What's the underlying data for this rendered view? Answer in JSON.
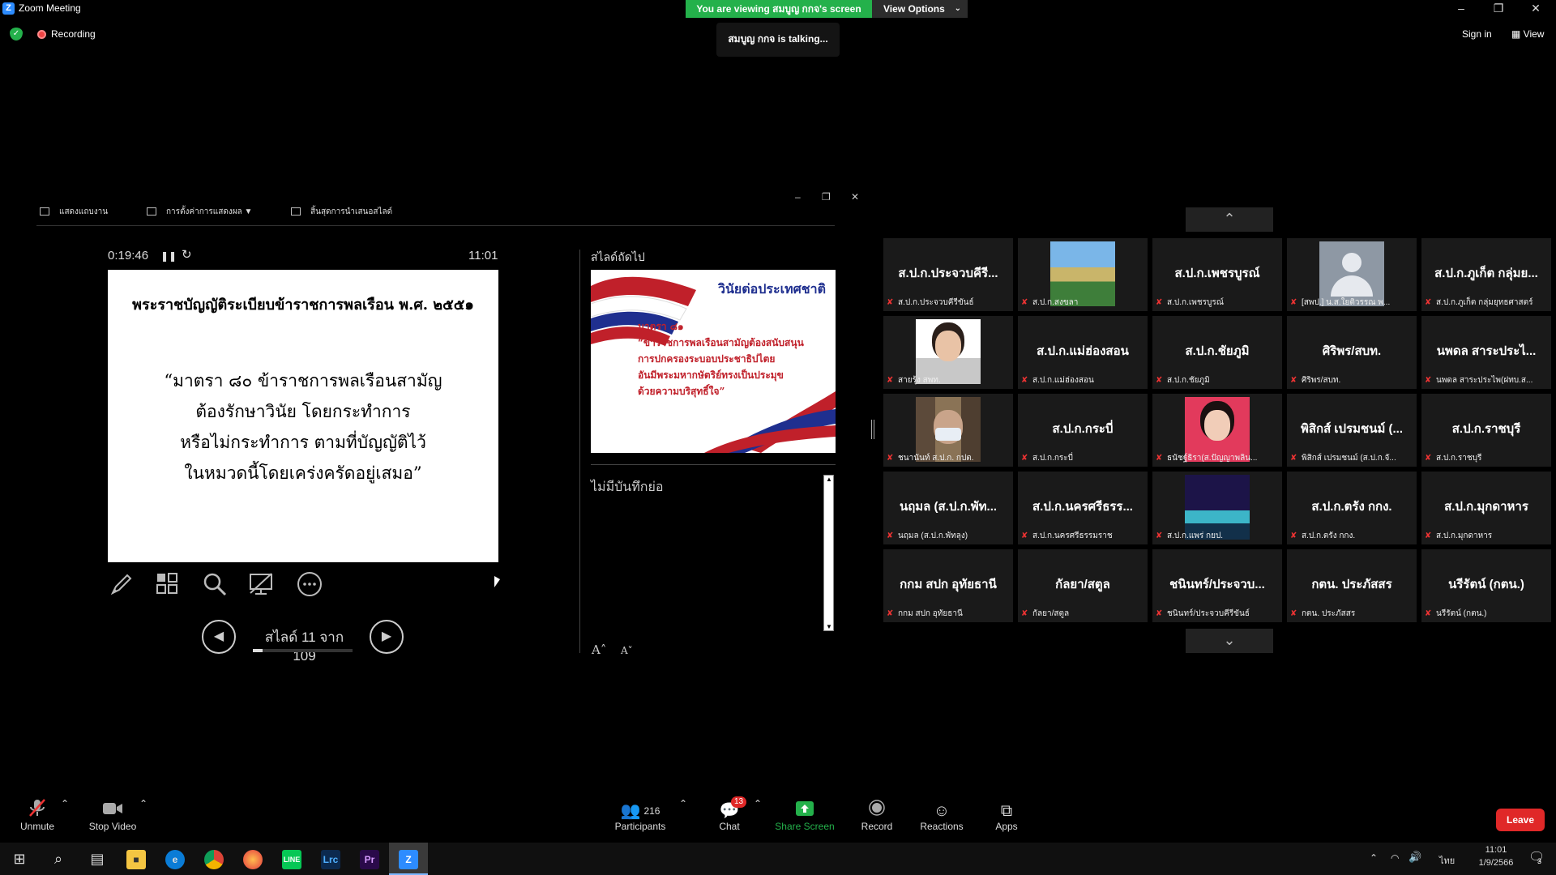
{
  "window": {
    "title": "Zoom Meeting",
    "viewing_banner": "You are viewing สมบูญ กกจ's screen",
    "view_options": "View Options",
    "talking": "สมบูญ กกจ is talking...",
    "recording": "Recording",
    "sign_in": "Sign in",
    "view": "View"
  },
  "presenter": {
    "toolbar": {
      "show_taskbar": "แสดงแถบงาน",
      "display_settings": "การตั้งค่าการแสดงผล ▼",
      "end_slideshow": "สิ้นสุดการนำเสนอสไลด์"
    },
    "timer": "0:19:46",
    "clock": "11:01",
    "current_slide": {
      "title": "พระราชบัญญัติระเบียบข้าราชการพลเรือน พ.ศ. ๒๕๕๑",
      "lines": [
        "“มาตรา ๘๐ ข้าราชการพลเรือนสามัญ",
        "ต้องรักษาวินัย โดยกระทำการ",
        "หรือไม่กระทำการ ตามที่บัญญัติไว้",
        "ในหมวดนี้โดยเคร่งครัดอยู่เสมอ”"
      ]
    },
    "slide_counter": "สไลด์ 11 จาก 109",
    "slide_progress": 0.1009,
    "next_label": "สไลด์ถัดไป",
    "next_slide": {
      "title": "วินัยต่อประเทศชาติ",
      "lines": [
        "มาตรา ๘๑",
        "“ข้าราชการพลเรือนสามัญต้องสนับสนุน",
        "การปกครองระบอบประชาธิปไตย",
        "อันมีพระมหากษัตริย์ทรงเป็นประมุข",
        "ด้วยความบริสุทธิ์ใจ”"
      ]
    },
    "notes": "ไม่มีบันทึกย่อ"
  },
  "gallery": {
    "tiles": [
      {
        "big": "ส.ป.ก.ประจวบคีรี...",
        "small": "ส.ป.ก.ประจวบคีรีขันธ์",
        "photo": ""
      },
      {
        "big": "",
        "small": "ส.ป.ก.สงขลา",
        "photo": "building"
      },
      {
        "big": "ส.ป.ก.เพชรบูรณ์",
        "small": "ส.ป.ก.เพชรบูรณ์",
        "photo": ""
      },
      {
        "big": "",
        "small": "[สพป.] น.ส.ใยติวรรณ พ...",
        "photo": "avatar"
      },
      {
        "big": "ส.ป.ก.ภูเก็ต กลุ่มย...",
        "small": "ส.ป.ก.ภูเก็ต กลุ่มยุทธศาสตร์",
        "photo": ""
      },
      {
        "big": "",
        "small": "สายรุ้ง สพท.",
        "photo": "woman"
      },
      {
        "big": "ส.ป.ก.แม่ฮ่องสอน",
        "small": "ส.ป.ก.แม่ฮ่องสอน",
        "photo": ""
      },
      {
        "big": "ส.ป.ก.ชัยภูมิ",
        "small": "ส.ป.ก.ชัยภูมิ",
        "photo": ""
      },
      {
        "big": "ศิริพร/สบท.",
        "small": "ศิริพร/สบท.",
        "photo": ""
      },
      {
        "big": "นพดล สาระประไ...",
        "small": "นพดล สาระประไพ(ฝทบ.ส...",
        "photo": ""
      },
      {
        "big": "",
        "small": "ชนานันท์ ส.ป.ก. กปต.",
        "photo": "man"
      },
      {
        "big": "ส.ป.ก.กระบี่",
        "small": "ส.ป.ก.กระบี่",
        "photo": ""
      },
      {
        "big": "",
        "small": "ธนัชฐ์ธิรา(ส.ปัญญาพลิน...",
        "photo": "girl"
      },
      {
        "big": "พิสิกส์ เปรมชนม์ (...",
        "small": "พิสิกส์ เปรมชนม์ (ส.ป.ก.จั...",
        "photo": ""
      },
      {
        "big": "ส.ป.ก.ราชบุรี",
        "small": "ส.ป.ก.ราชบุรี",
        "photo": ""
      },
      {
        "big": "นฤมล (ส.ป.ก.พัท...",
        "small": "นฤมล (ส.ป.ก.พัทลุง)",
        "photo": ""
      },
      {
        "big": "ส.ป.ก.นครศรีธรร...",
        "small": "ส.ป.ก.นครศรีธรรมราช",
        "photo": ""
      },
      {
        "big": "",
        "small": "ส.ป.ก.แพร่ กยป.",
        "photo": "night"
      },
      {
        "big": "ส.ป.ก.ตรัง กกง.",
        "small": "ส.ป.ก.ตรัง กกง.",
        "photo": ""
      },
      {
        "big": "ส.ป.ก.มุกดาหาร",
        "small": "ส.ป.ก.มุกดาหาร",
        "photo": ""
      },
      {
        "big": "กกม สปก อุทัยธานี",
        "small": "กกม สปก อุทัยธานี",
        "photo": ""
      },
      {
        "big": "กัลยา/สตูล",
        "small": "กัลยา/สตูล",
        "photo": ""
      },
      {
        "big": "ชนินทร์/ประจวบ...",
        "small": "ชนินทร์/ประจวบคีรีขันธ์",
        "photo": ""
      },
      {
        "big": "กตน. ประภัสสร",
        "small": "กตน. ประภัสสร",
        "photo": ""
      },
      {
        "big": "นรีรัตน์ (กตน.)",
        "small": "นรีรัตน์ (กตน.)",
        "photo": ""
      }
    ]
  },
  "controls": {
    "unmute": "Unmute",
    "stop_video": "Stop Video",
    "participants": "Participants",
    "participants_count": "216",
    "chat": "Chat",
    "chat_badge": "13",
    "share_screen": "Share Screen",
    "record": "Record",
    "reactions": "Reactions",
    "apps": "Apps",
    "leave": "Leave"
  },
  "taskbar": {
    "apps": [
      "start-icon",
      "search-icon",
      "task-view-icon",
      "explorer-icon",
      "edge-icon",
      "chrome-icon",
      "firefox-icon",
      "line-icon",
      "lightroom-icon",
      "premiere-icon",
      "zoom-icon"
    ],
    "lang": "ไทย",
    "time": "11:01",
    "date": "1/9/2566",
    "notification_count": "3",
    "colors": {
      "zoom": "#2d8cff",
      "line": "#06c755",
      "lrc": "#0c2a4f",
      "pr": "#2a0a4a"
    }
  }
}
